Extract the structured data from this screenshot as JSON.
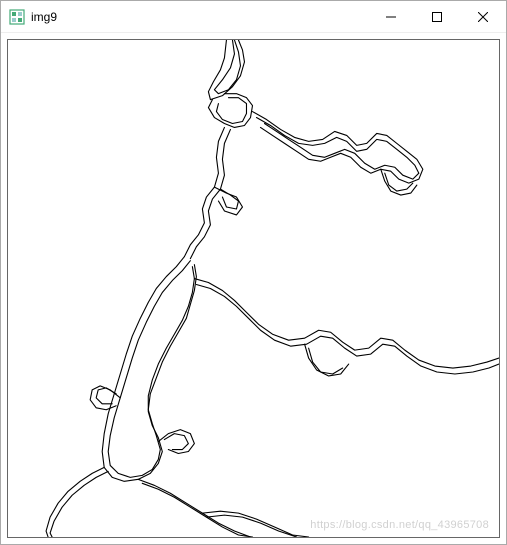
{
  "window": {
    "title": "img9",
    "icon_name": "image-viewer-icon"
  },
  "controls": {
    "minimize": "Minimize",
    "maximize": "Maximize",
    "close": "Close"
  },
  "watermark": "https://blog.csdn.net/qq_43965708",
  "colors": {
    "window_border": "#aaaaaa",
    "titlebar_bg": "#ffffff",
    "content_bg": "#ffffff",
    "stroke": "#000000"
  }
}
